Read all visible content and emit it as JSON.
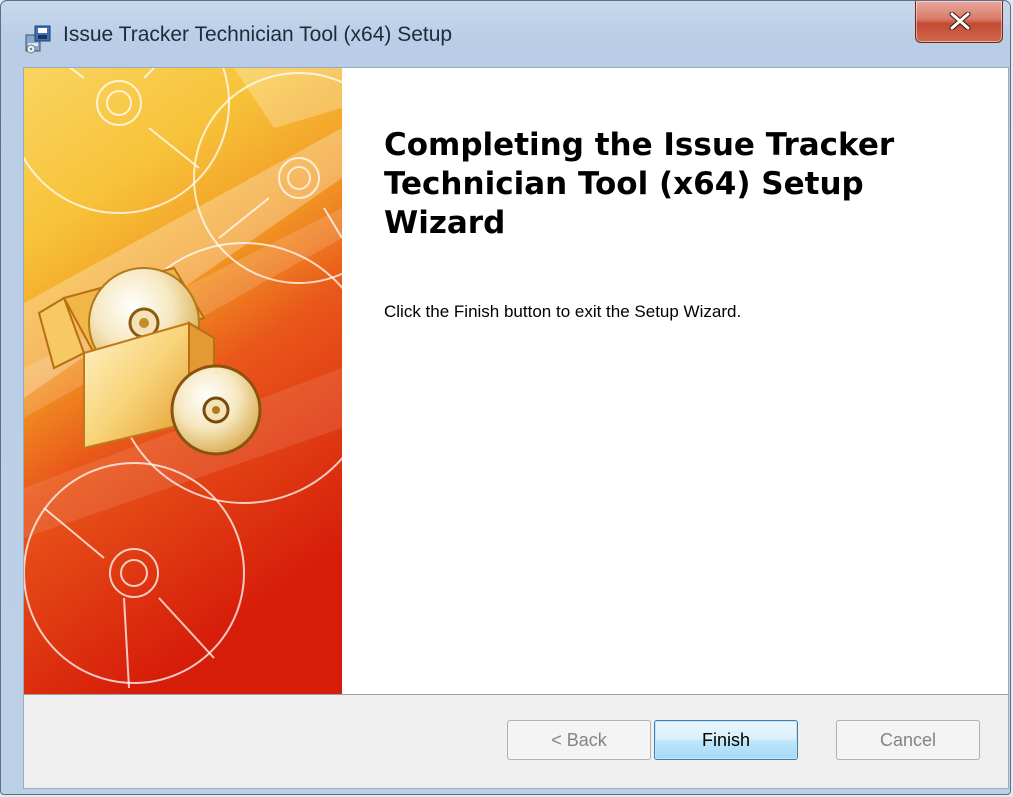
{
  "window": {
    "title": "Issue Tracker Technician Tool (x64) Setup",
    "close_glyph": "x",
    "icon": "installer-icon"
  },
  "wizard": {
    "heading": "Completing the Issue Tracker Technician Tool (x64) Setup Wizard",
    "body": "Click the Finish button to exit the Setup Wizard.",
    "banner_image": "setup-banner-discs-box"
  },
  "buttons": {
    "back": "< Back",
    "finish": "Finish",
    "cancel": "Cancel"
  },
  "colors": {
    "banner_top": "#f7c63a",
    "banner_mid": "#ef8c1e",
    "banner_bottom": "#d9260c",
    "close_button": "#c8553f",
    "default_button_border": "#3c7fb1"
  }
}
